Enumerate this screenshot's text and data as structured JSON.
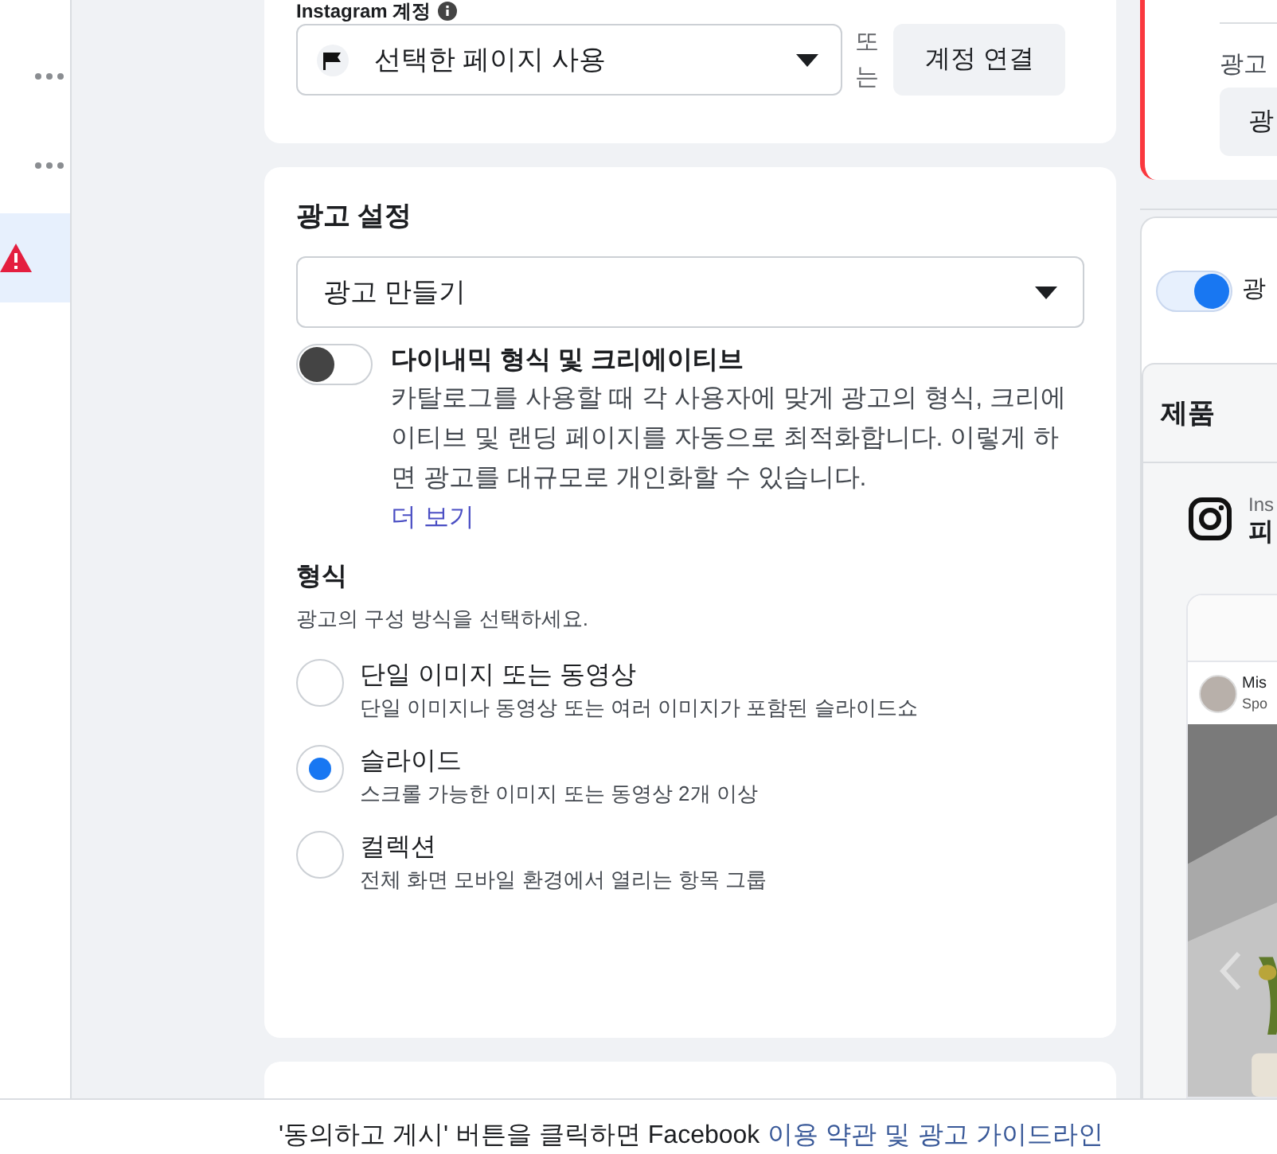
{
  "sidebar": {
    "items": [
      {
        "kind": "more",
        "selected": false
      },
      {
        "kind": "more",
        "selected": false
      },
      {
        "kind": "warning",
        "selected": true
      }
    ]
  },
  "identity": {
    "label": "Instagram 계정",
    "page_select": {
      "value": "선택한 페이지 사용"
    },
    "or_text": "또는",
    "connect_button": "계정 연결"
  },
  "ad_settings": {
    "title": "광고 설정",
    "select": {
      "value": "광고 만들기"
    },
    "dynamic": {
      "on": false,
      "title": "다이내믹 형식 및 크리에이티브",
      "description": "카탈로그를 사용할 때 각 사용자에 맞게 광고의 형식, 크리에이티브 및 랜딩 페이지를 자동으로 최적화합니다. 이렇게 하면 광고를 대규모로 개인화할 수 있습니다.",
      "more_link": "더 보기"
    },
    "format": {
      "title": "형식",
      "subtitle": "광고의 구성 방식을 선택하세요.",
      "options": [
        {
          "label": "단일 이미지 또는 동영상",
          "description": "단일 이미지나 동영상 또는 여러 이미지가 포함된 슬라이드쇼",
          "selected": false
        },
        {
          "label": "슬라이드",
          "description": "스크롤 가능한 이미지 또는 동영상 2개 이상",
          "selected": true
        },
        {
          "label": "컬렉션",
          "description": "전체 화면 모바일 환경에서 열리는 항목 그룹",
          "selected": false
        }
      ]
    }
  },
  "right_panel": {
    "label": "광고",
    "button": "광",
    "toggle": {
      "on": true,
      "label": "광"
    },
    "products_title": "제품",
    "account_name": "Ins",
    "account_title": "피",
    "preview": {
      "name": "Mis",
      "sponsored": "Spo"
    }
  },
  "footer": {
    "text": "'동의하고 게시' 버튼을 클릭하면 Facebook",
    "links": [
      "이용 약관",
      "광고 가이드라인"
    ],
    "joiner": "및"
  }
}
